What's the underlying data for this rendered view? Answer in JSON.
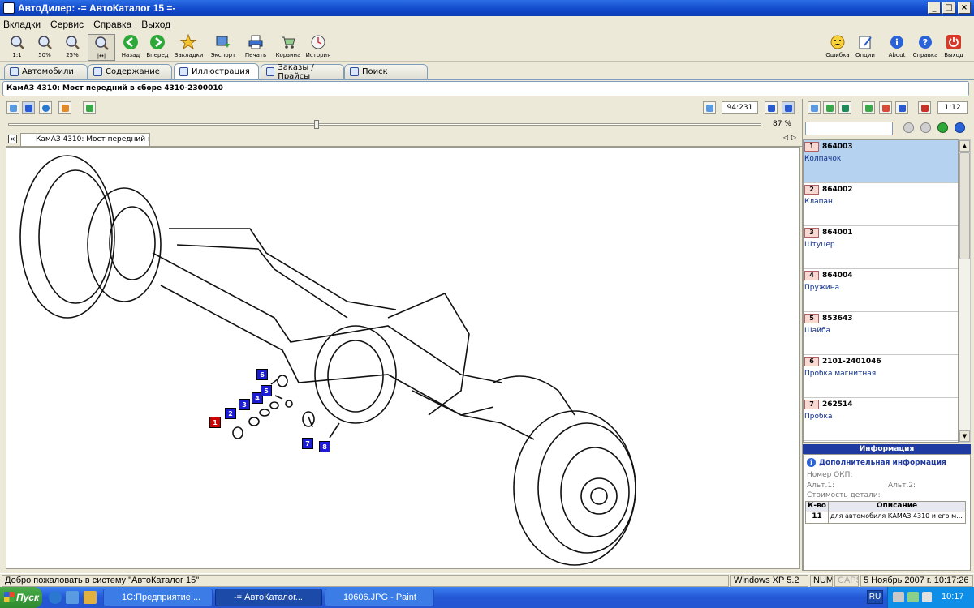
{
  "window": {
    "title": "АвтоДилер: -= АвтоКаталог 15 =-"
  },
  "menu": [
    "Вкладки",
    "Сервис",
    "Справка",
    "Выход"
  ],
  "toolbar": {
    "zoom_labels": [
      "1:1",
      "50%",
      "25%",
      ""
    ],
    "buttons": [
      "Назад",
      "Вперед",
      "Закладки",
      "Экспорт",
      "Печать",
      "Корзина",
      "История"
    ],
    "right_buttons": [
      "Ошибка",
      "Опции",
      "About",
      "Справка",
      "Выход"
    ]
  },
  "tabs": [
    "Автомобили",
    "Содержание",
    "Иллюстрация",
    "Заказы / Прайсы",
    "Поиск"
  ],
  "breadcrumb": "КамАЗ 4310: Мост передний в сборе 4310-2300010",
  "viewer": {
    "coords": "94:231",
    "zoom": "87 %",
    "zoom_fraction": 0.41,
    "doc_tab": "КамАЗ 4310: Мост передний в...",
    "scale": "1:12"
  },
  "callouts": [
    "1",
    "2",
    "3",
    "4",
    "5",
    "6",
    "7",
    "8"
  ],
  "parts": [
    {
      "num": "1",
      "code": "864003",
      "name": "Колпачок"
    },
    {
      "num": "2",
      "code": "864002",
      "name": "Клапан"
    },
    {
      "num": "3",
      "code": "864001",
      "name": "Штуцер"
    },
    {
      "num": "4",
      "code": "864004",
      "name": "Пружина"
    },
    {
      "num": "5",
      "code": "853643",
      "name": "Шайба"
    },
    {
      "num": "6",
      "code": "2101-2401046",
      "name": "Пробка магнитная"
    },
    {
      "num": "7",
      "code": "262514",
      "name": "Пробка"
    }
  ],
  "info": {
    "header": "Информация",
    "title": "Дополнительная информация",
    "okp": "Номер ОКП:",
    "alt1": "Альт.1:",
    "alt2": "Альт.2:",
    "cost": "Стоимость детали:",
    "col_qty": "К-во",
    "col_desc": "Описание",
    "qty": "11",
    "desc": "для автомобиля КАМАЗ 4310 и его м..."
  },
  "status": {
    "message": "Добро пожаловать в систему \"АвтоКаталог 15\"",
    "os": "Windows XP 5.2",
    "num": "NUM",
    "caps": "CAPS",
    "date": "5 Ноябрь 2007 г. 10:17:26"
  },
  "taskbar": {
    "start": "Пуск",
    "tasks": [
      "1С:Предприятие ...",
      "-= АвтоКаталог...",
      "10606.JPG - Paint"
    ],
    "lang": "RU",
    "clock": "10:17"
  },
  "colors": {
    "callout": "#1c1cd6",
    "callout_selected": "#d10000",
    "selected_row": "#b5d2f0",
    "info_header": "#1f3aa0"
  }
}
